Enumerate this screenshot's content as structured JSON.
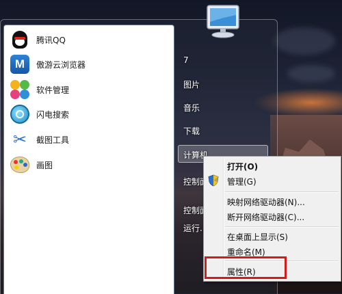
{
  "start_menu": {
    "programs": [
      {
        "label": "腾讯QQ",
        "icon": "qq-penguin-icon"
      },
      {
        "label": "傲游云浏览器",
        "icon": "maxthon-icon"
      },
      {
        "label": "软件管理",
        "icon": "software-manager-icon"
      },
      {
        "label": "闪电搜索",
        "icon": "flash-search-icon"
      },
      {
        "label": "截图工具",
        "icon": "scissors-icon"
      },
      {
        "label": "画图",
        "icon": "paint-palette-icon"
      }
    ],
    "right_items": {
      "user": "7",
      "pictures": "图片",
      "music": "音乐",
      "downloads": "下载",
      "computer": "计算机",
      "control_panel_1": "控制面",
      "control_panel_2": "控制面",
      "run": "运行..."
    }
  },
  "context_menu": {
    "open": "打开(O)",
    "manage": "管理(G)",
    "map_drive": "映射网络驱动器(N)...",
    "disconnect_drive": "断开网络驱动器(C)...",
    "show_on_desktop": "在桌面上显示(S)",
    "rename": "重命名(M)",
    "properties": "属性(R)"
  },
  "colors": {
    "highlight_box": "#d61a1a",
    "menu_background": "#f0f0f0"
  }
}
